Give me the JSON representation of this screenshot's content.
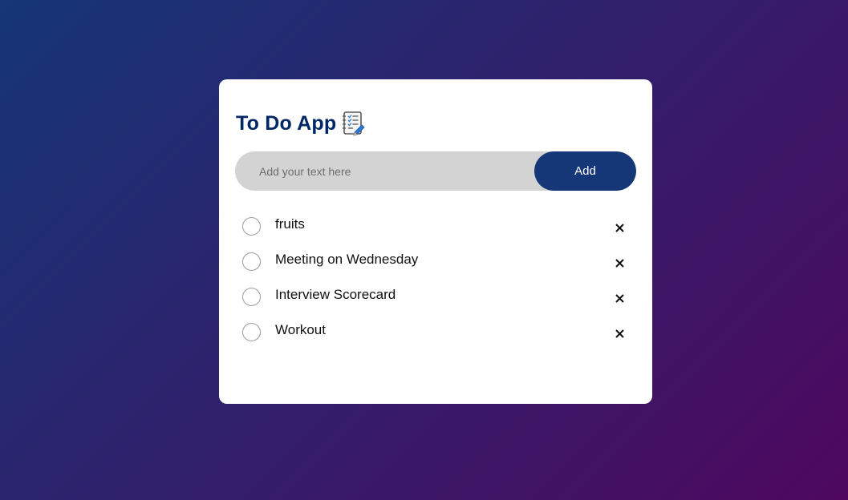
{
  "app": {
    "title": "To Do App",
    "title_icon": "notebook-checklist-icon",
    "accent_color": "#153677",
    "title_color": "#002765"
  },
  "input": {
    "value": "",
    "placeholder": "Add your text here"
  },
  "add_button": {
    "label": "Add"
  },
  "tasks": [
    {
      "text": "fruits",
      "checked": false
    },
    {
      "text": "Meeting on Wednesday",
      "checked": false
    },
    {
      "text": "Interview Scorecard",
      "checked": false
    },
    {
      "text": "Workout",
      "checked": false
    }
  ],
  "icons": {
    "checkbox": "circle-unchecked-icon",
    "delete": "close-icon"
  }
}
